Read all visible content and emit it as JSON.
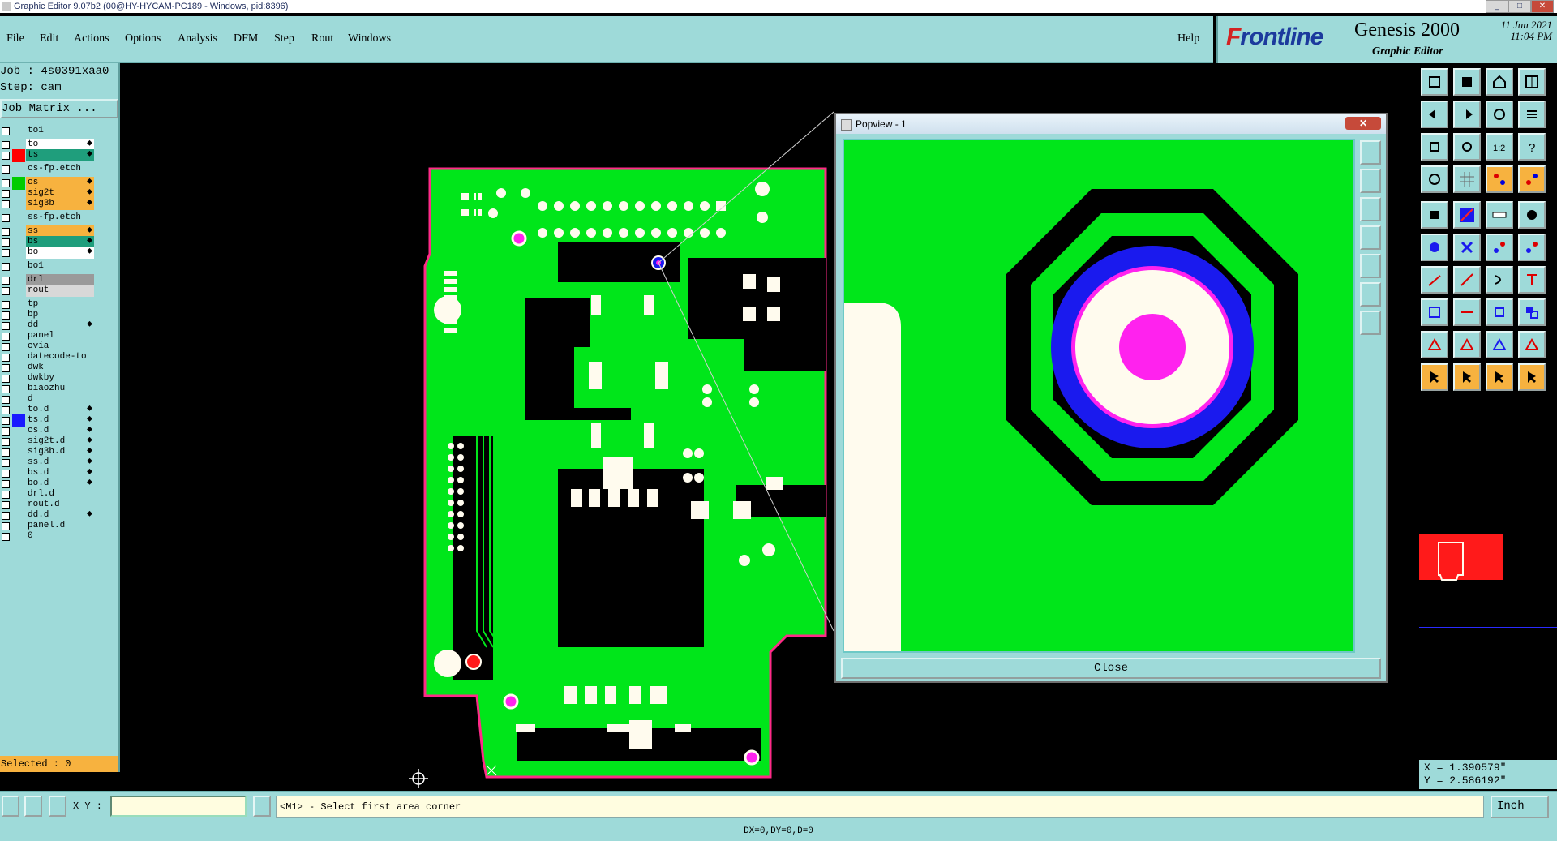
{
  "window": {
    "title": "Graphic Editor 9.07b2 (00@HY-HYCAM-PC189 - Windows, pid:8396)"
  },
  "menu": {
    "items": [
      "File",
      "Edit",
      "Actions",
      "Options",
      "Analysis",
      "DFM",
      "Step",
      "Rout",
      "Windows"
    ],
    "help": "Help"
  },
  "brand": {
    "logo_a": "F",
    "logo_b": "rontline",
    "product": "Genesis 2000",
    "subtitle": "Graphic Editor",
    "date": "11 Jun 2021",
    "time": "11:04 PM"
  },
  "job": {
    "job_line": "Job : 4s0391xaa0",
    "step_line": "Step: cam",
    "matrix_button": "Job Matrix ..."
  },
  "layers": [
    {
      "name": "to1",
      "bg": "#9edad9",
      "swatch": "",
      "edit": false
    },
    {
      "name": "to",
      "bg": "#ffffff",
      "swatch": "",
      "edit": true
    },
    {
      "name": "ts",
      "bg": "#1f9e7c",
      "swatch": "#ff0000",
      "edit": true
    },
    {
      "name": "cs-fp.etch",
      "bg": "#9edad9",
      "swatch": "",
      "edit": false
    },
    {
      "name": "cs",
      "bg": "#f7b23f",
      "swatch": "#00cc00",
      "edit": true
    },
    {
      "name": "sig2t",
      "bg": "#f7b23f",
      "swatch": "",
      "edit": true
    },
    {
      "name": "sig3b",
      "bg": "#f7b23f",
      "swatch": "",
      "edit": true
    },
    {
      "name": "ss-fp.etch",
      "bg": "#9edad9",
      "swatch": "",
      "edit": false
    },
    {
      "name": "ss",
      "bg": "#f7b23f",
      "swatch": "",
      "edit": true
    },
    {
      "name": "bs",
      "bg": "#1f9e7c",
      "swatch": "",
      "edit": true
    },
    {
      "name": "bo",
      "bg": "#ffffff",
      "swatch": "",
      "edit": true
    },
    {
      "name": "bo1",
      "bg": "#9edad9",
      "swatch": "",
      "edit": false
    },
    {
      "name": "drl",
      "bg": "#9a9a9a",
      "swatch": "",
      "edit": false
    },
    {
      "name": "rout",
      "bg": "#d8d8d8",
      "swatch": "",
      "edit": false
    },
    {
      "name": "tp",
      "bg": "#9edad9",
      "swatch": "",
      "edit": false
    },
    {
      "name": "bp",
      "bg": "#9edad9",
      "swatch": "",
      "edit": false
    },
    {
      "name": "dd",
      "bg": "#9edad9",
      "swatch": "",
      "edit": true
    },
    {
      "name": "panel",
      "bg": "#9edad9",
      "swatch": "",
      "edit": false
    },
    {
      "name": "cvia",
      "bg": "#9edad9",
      "swatch": "",
      "edit": false
    },
    {
      "name": "datecode-to",
      "bg": "#9edad9",
      "swatch": "",
      "edit": false
    },
    {
      "name": "dwk",
      "bg": "#9edad9",
      "swatch": "",
      "edit": false
    },
    {
      "name": "dwkby",
      "bg": "#9edad9",
      "swatch": "",
      "edit": false
    },
    {
      "name": "biaozhu",
      "bg": "#9edad9",
      "swatch": "",
      "edit": false
    },
    {
      "name": "d",
      "bg": "#9edad9",
      "swatch": "",
      "edit": false
    },
    {
      "name": "to.d",
      "bg": "#9edad9",
      "swatch": "",
      "edit": true
    },
    {
      "name": "ts.d",
      "bg": "#9edad9",
      "swatch": "#1a1aff",
      "edit": true
    },
    {
      "name": "cs.d",
      "bg": "#9edad9",
      "swatch": "",
      "edit": true
    },
    {
      "name": "sig2t.d",
      "bg": "#9edad9",
      "swatch": "",
      "edit": true
    },
    {
      "name": "sig3b.d",
      "bg": "#9edad9",
      "swatch": "",
      "edit": true
    },
    {
      "name": "ss.d",
      "bg": "#9edad9",
      "swatch": "",
      "edit": true
    },
    {
      "name": "bs.d",
      "bg": "#9edad9",
      "swatch": "",
      "edit": true
    },
    {
      "name": "bo.d",
      "bg": "#9edad9",
      "swatch": "",
      "edit": true
    },
    {
      "name": "drl.d",
      "bg": "#9edad9",
      "swatch": "",
      "edit": false
    },
    {
      "name": "rout.d",
      "bg": "#9edad9",
      "swatch": "",
      "edit": false
    },
    {
      "name": "dd.d",
      "bg": "#9edad9",
      "swatch": "",
      "edit": true
    },
    {
      "name": "panel.d",
      "bg": "#9edad9",
      "swatch": "",
      "edit": false
    },
    {
      "name": "0",
      "bg": "#9edad9",
      "swatch": "",
      "edit": false
    }
  ],
  "selected": "Selected : 0",
  "popview": {
    "title": "Popview - 1",
    "close_button": "Close",
    "close_x": "✕"
  },
  "status": {
    "xy_label": "X Y :",
    "prompt": "<M1> - Select first area corner",
    "units": "Inch",
    "delta": "DX=0,DY=0,D=0"
  },
  "coordinates": {
    "x": "X = 1.390579\"",
    "y": "Y = 2.586192\""
  },
  "colors": {
    "panel_bg": "#9edad9",
    "board_copper": "#00e61a",
    "board_outline": "#ff2a88",
    "pad_white": "#fffbee",
    "via_magenta": "#ff22ee",
    "via_blue": "#1a1aee",
    "selected_orange": "#f7b23f"
  }
}
